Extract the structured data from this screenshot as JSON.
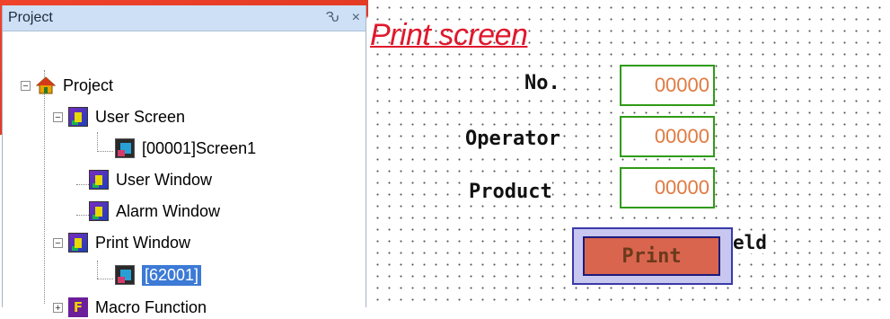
{
  "panel": {
    "title": "Project",
    "pin_glyph": "Ԅ",
    "close_glyph": "×"
  },
  "tree": [
    {
      "label": "Project",
      "icon": "home-icon",
      "expander": "−"
    },
    {
      "label": "User Screen",
      "icon": "screen-icon",
      "expander": "−"
    },
    {
      "label": "[00001]Screen1",
      "icon": "picture-icon"
    },
    {
      "label": "User Window",
      "icon": "screen-icon"
    },
    {
      "label": "Alarm Window",
      "icon": "screen-icon"
    },
    {
      "label": "Print Window",
      "icon": "screen-icon",
      "expander": "−"
    },
    {
      "label": "[62001]",
      "icon": "picture-icon",
      "selected": true
    },
    {
      "label": "Macro Function",
      "icon": "macro-f-icon",
      "expander": "+",
      "icon_letter": "F"
    }
  ],
  "canvas": {
    "title": "Print screen",
    "fields": [
      {
        "label": "No.",
        "value": "00000"
      },
      {
        "label": "Operator",
        "value": "00000"
      },
      {
        "label": "Product",
        "value": "00000"
      }
    ],
    "print_button": "Print",
    "partial_text": "eld"
  },
  "colors": {
    "title": "#e0182d",
    "field_border": "#2f9b16",
    "field_text": "#e07a40",
    "button_face": "#d9654f",
    "selection": "#3c7ad6"
  }
}
